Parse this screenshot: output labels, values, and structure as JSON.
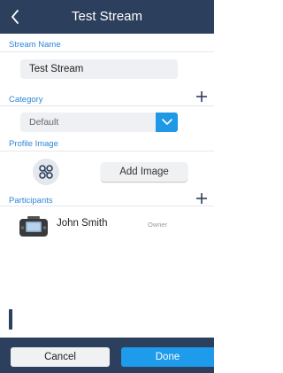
{
  "header": {
    "title": "Test Stream",
    "back_icon": "chevron-left-icon"
  },
  "stream_name": {
    "label": "Stream Name",
    "value": "Test Stream"
  },
  "category": {
    "label": "Category",
    "selected": "Default",
    "add_icon": "plus-icon",
    "dropdown_icon": "chevron-down-icon"
  },
  "profile_image": {
    "label": "Profile Image",
    "icon": "stream-share-icon",
    "add_button": "Add Image"
  },
  "participants": {
    "label": "Participants",
    "add_icon": "plus-icon",
    "items": [
      {
        "name": "John Smith",
        "role": "Owner",
        "avatar_icon": "device-avatar-icon"
      }
    ]
  },
  "footer": {
    "cancel_label": "Cancel",
    "done_label": "Done"
  },
  "colors": {
    "nav_bg": "#2c3f5c",
    "accent": "#2e86d8",
    "done_button": "#1e9bea",
    "field_bg": "#eef0f3"
  }
}
